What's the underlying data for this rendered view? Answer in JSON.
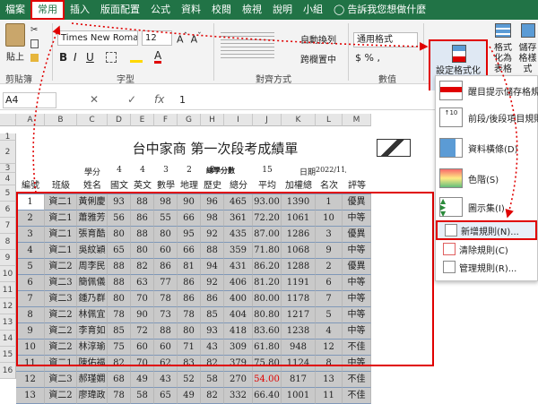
{
  "tabs": [
    "檔案",
    "常用",
    "插入",
    "版面配置",
    "公式",
    "資料",
    "校閱",
    "檢視",
    "說明",
    "小組"
  ],
  "tell_me": "告訴我您想做什麼",
  "ribbon": {
    "paste": "貼上",
    "clipboard": "剪貼簿",
    "font_name": "Times New Roman",
    "font_size": "12",
    "font_group": "字型",
    "wrap_text": "自動換列",
    "merge_center": "跨欄置中",
    "alignment_group": "對齊方式",
    "number_format": "通用格式",
    "number_group": "數值",
    "conditional_formatting": "設定格式化的條件",
    "format_as_table": "格式化為表格",
    "cell_styles": "儲存格樣式"
  },
  "formula_bar": {
    "name_box": "A4",
    "fx": "fx",
    "content": "1"
  },
  "columns": [
    "A",
    "B",
    "C",
    "D",
    "E",
    "F",
    "G",
    "H",
    "I",
    "J",
    "K",
    "L",
    "M"
  ],
  "rows": [
    "1",
    "2",
    "3",
    "4",
    "5",
    "6",
    "7",
    "8",
    "9",
    "10",
    "11",
    "12",
    "13",
    "14",
    "15",
    "16"
  ],
  "sheet": {
    "title": "台中家商 第一次段考成績單",
    "row2": {
      "credits_label": "學分",
      "credits": [
        "4",
        "4",
        "3",
        "2",
        "2"
      ],
      "total_credits_label": "總學分數",
      "total_credits": "15",
      "date_label": "日期",
      "date": "2022/11/4"
    },
    "headers": [
      "編號",
      "班級",
      "姓名",
      "國文",
      "英文",
      "數學",
      "地理",
      "歷史",
      "總分",
      "平均",
      "加權總分",
      "名次",
      "評等"
    ],
    "data": [
      [
        "1",
        "資二1",
        "黃俐慶",
        "93",
        "88",
        "98",
        "90",
        "96",
        "465",
        "93.00",
        "1390",
        "1",
        "優異"
      ],
      [
        "2",
        "資二1",
        "蕭雅芳",
        "56",
        "86",
        "55",
        "66",
        "98",
        "361",
        "72.20",
        "1061",
        "10",
        "中等"
      ],
      [
        "3",
        "資二1",
        "張育酷",
        "80",
        "88",
        "80",
        "95",
        "92",
        "435",
        "87.00",
        "1286",
        "3",
        "優異"
      ],
      [
        "4",
        "資二1",
        "吳紋穎",
        "65",
        "80",
        "60",
        "66",
        "88",
        "359",
        "71.80",
        "1068",
        "9",
        "中等"
      ],
      [
        "5",
        "資二2",
        "周李民",
        "88",
        "82",
        "86",
        "81",
        "94",
        "431",
        "86.20",
        "1288",
        "2",
        "優異"
      ],
      [
        "6",
        "資二3",
        "簡佩儀",
        "88",
        "63",
        "77",
        "86",
        "92",
        "406",
        "81.20",
        "1191",
        "6",
        "中等"
      ],
      [
        "7",
        "資二3",
        "鍾乃群",
        "80",
        "70",
        "78",
        "86",
        "86",
        "400",
        "80.00",
        "1178",
        "7",
        "中等"
      ],
      [
        "8",
        "資二2",
        "林佩宜",
        "78",
        "90",
        "73",
        "78",
        "85",
        "404",
        "80.80",
        "1217",
        "5",
        "中等"
      ],
      [
        "9",
        "資二2",
        "李育如",
        "85",
        "72",
        "88",
        "80",
        "93",
        "418",
        "83.60",
        "1238",
        "4",
        "中等"
      ],
      [
        "10",
        "資二2",
        "林淳瑜",
        "75",
        "60",
        "60",
        "71",
        "43",
        "309",
        "61.80",
        "948",
        "12",
        "不佳"
      ],
      [
        "11",
        "資二1",
        "陳佑福",
        "82",
        "70",
        "62",
        "83",
        "82",
        "379",
        "75.80",
        "1124",
        "8",
        "中等"
      ],
      [
        "12",
        "資二3",
        "郝瑾嫻",
        "68",
        "49",
        "43",
        "52",
        "58",
        "270",
        "54.00",
        "817",
        "13",
        "不佳"
      ],
      [
        "13",
        "資二2",
        "廖瑋政",
        "78",
        "58",
        "65",
        "49",
        "82",
        "332",
        "66.40",
        "1001",
        "11",
        "不佳"
      ]
    ],
    "red_value": "54.00"
  },
  "cf_menu": {
    "items": [
      "醒目提示儲存格規則(H)",
      "前段/後段項目規則(T)",
      "資料橫條(D)",
      "色階(S)",
      "圖示集(I)"
    ],
    "new_rule": "新增規則(N)...",
    "clear_rules": "清除規則(C)",
    "manage_rules": "管理規則(R)..."
  },
  "colors": {
    "accent": "#217346",
    "highlight": "#e00000",
    "selection": "#c9c9c9"
  }
}
